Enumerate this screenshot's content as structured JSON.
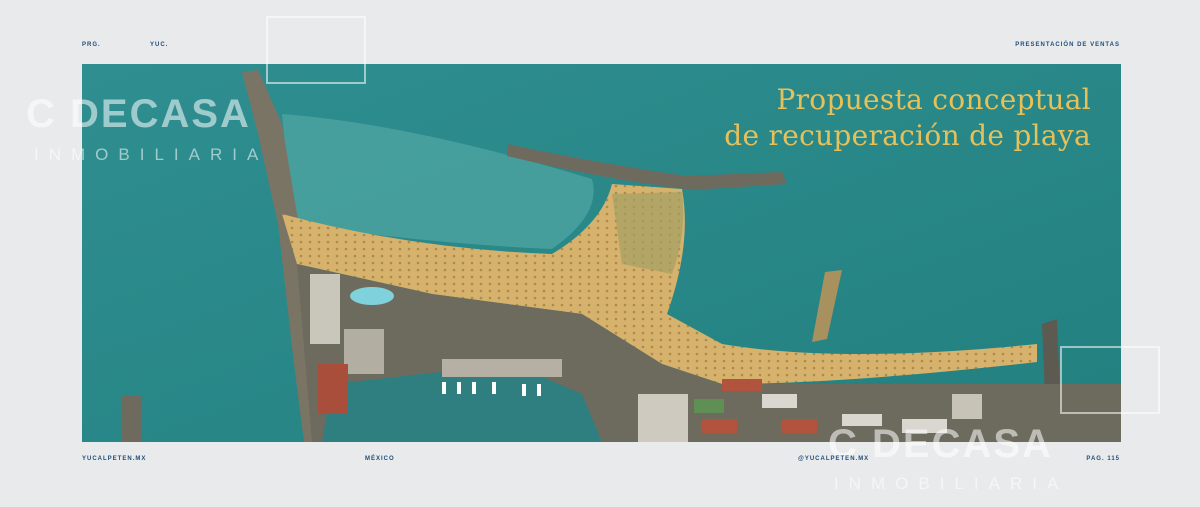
{
  "header": {
    "left_a": "PRG.",
    "left_b": "YUC.",
    "right": "PRESENTACIÓN DE VENTAS"
  },
  "footer": {
    "website": "YUCALPETEN.MX",
    "country": "MÉXICO",
    "social": "@YUCALPETEN.MX",
    "page": "PAG. 115"
  },
  "hero": {
    "title_line1": "Propuesta conceptual",
    "title_line2": "de recuperación de playa"
  },
  "watermark": {
    "brand_a": "C DECASA",
    "brand_b": "INMOBILIARIA"
  },
  "colors": {
    "sea": "#2c8b8d",
    "sand": "#d8b772",
    "title": "#e6c15a",
    "ink": "#1f4d7a",
    "page_bg": "#e9eaec"
  }
}
